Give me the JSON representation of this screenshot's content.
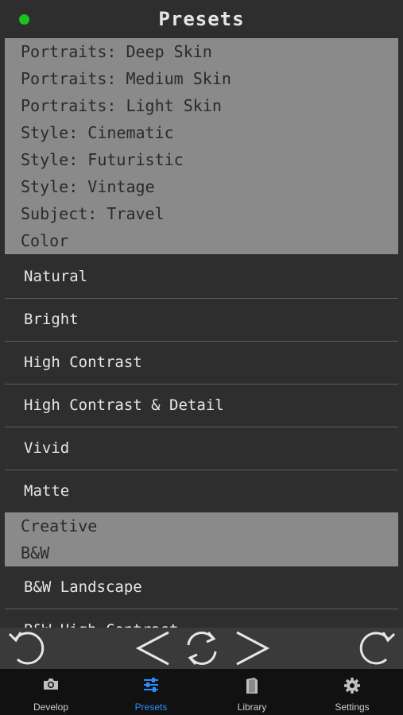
{
  "header": {
    "title": "Presets"
  },
  "groups": [
    {
      "items": [
        "Portraits: Deep Skin",
        "Portraits: Medium Skin",
        "Portraits: Light Skin",
        "Style: Cinematic",
        "Style: Futuristic",
        "Style: Vintage",
        "Subject: Travel",
        "Color"
      ]
    },
    {
      "items": [
        "Creative",
        "B&W"
      ]
    }
  ],
  "color_presets": [
    "Natural",
    "Bright",
    "High Contrast",
    "High Contrast & Detail",
    "Vivid",
    "Matte"
  ],
  "bw_presets": [
    "B&W Landscape",
    "B&W High Contrast"
  ],
  "toolbar": {
    "buttons": [
      "undo-icon",
      "previous-icon",
      "reset-icon",
      "next-icon",
      "redo-icon"
    ]
  },
  "tabs": [
    {
      "label": "Develop",
      "icon": "camera-icon",
      "active": false
    },
    {
      "label": "Presets",
      "icon": "sliders-icon",
      "active": true
    },
    {
      "label": "Library",
      "icon": "library-icon",
      "active": false
    },
    {
      "label": "Settings",
      "icon": "gear-icon",
      "active": false
    }
  ],
  "colors": {
    "accent": "#2f8cff",
    "status_dot": "#19c21c",
    "group_bg": "#8a8a8a",
    "bg": "#2e2e2e"
  }
}
